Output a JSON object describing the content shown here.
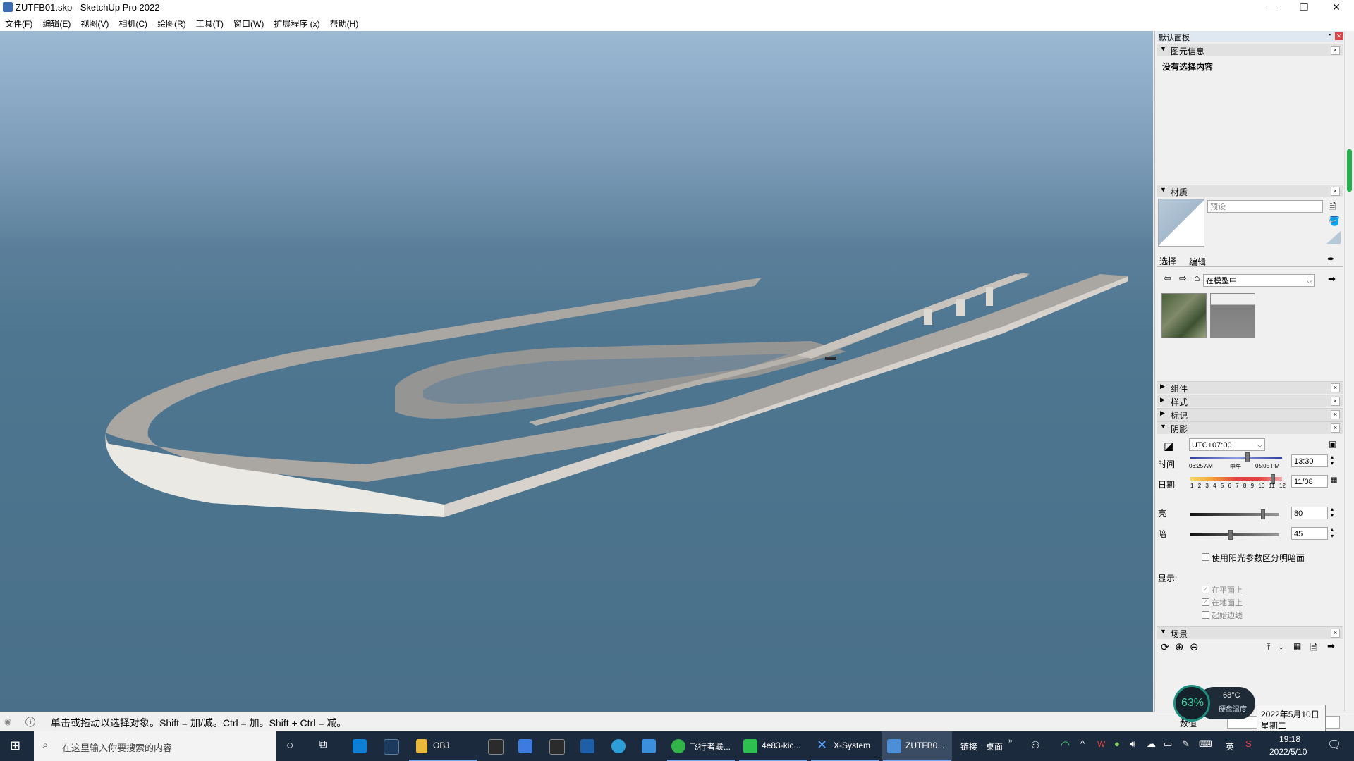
{
  "window": {
    "title": "ZUTFB01.skp - SketchUp Pro 2022",
    "minimize": "—",
    "maximize": "❐",
    "close": "✕"
  },
  "menu": [
    "文件(F)",
    "编辑(E)",
    "视图(V)",
    "相机(C)",
    "绘图(R)",
    "工具(T)",
    "窗口(W)",
    "扩展程序 (x)",
    "帮助(H)"
  ],
  "tray_title": "默认面板",
  "entity_info": {
    "header": "图元信息",
    "message": "没有选择内容"
  },
  "materials": {
    "header": "材质",
    "name_placeholder": "预设",
    "tab_select": "选择",
    "tab_edit": "编辑",
    "library": "在模型中"
  },
  "collapsed_sections": [
    "组件",
    "样式",
    "标记"
  ],
  "shadows": {
    "header": "阴影",
    "timezone": "UTC+07:00",
    "time_label": "时间",
    "sunrise": "06:25 AM",
    "noon": "中午",
    "sunset": "05:05 PM",
    "time_value": "13:30",
    "date_label": "日期",
    "months": [
      "1",
      "2",
      "3",
      "4",
      "5",
      "6",
      "7",
      "8",
      "9",
      "10",
      "11",
      "12"
    ],
    "date_value": "11/08",
    "light_label": "亮",
    "light_value": "80",
    "dark_label": "暗",
    "dark_value": "45",
    "use_sun_label": "使用阳光参数区分明暗面",
    "display_label": "显示:",
    "on_faces": "在平面上",
    "on_ground": "在地面上",
    "from_edges": "起始边线"
  },
  "scenes": {
    "header": "场景"
  },
  "status": {
    "text": "单击或拖动以选择对象。Shift = 加/减。Ctrl = 加。Shift + Ctrl = 减。",
    "measure_label": "数值"
  },
  "overlay": {
    "cpu_percent": "63%",
    "temp": "68°C",
    "temp_label": "硬盘温度",
    "tooltip_date": "2022年5月10日",
    "tooltip_day": "星期二"
  },
  "taskbar": {
    "search_placeholder": "在这里输入你要搜索的内容",
    "apps": [
      "OBJ",
      "飞行者联...",
      "4e83-kic...",
      "X-System",
      "ZUTFB0..."
    ],
    "links": "链接",
    "desktop": "桌面",
    "ime": "英",
    "time": "19:18",
    "date": "2022/5/10"
  },
  "colors": {
    "sky_top": "#9cb9d4",
    "ground": "#4a7089",
    "taskbar": "#1b2a3d",
    "accent": "#3b6db4"
  }
}
